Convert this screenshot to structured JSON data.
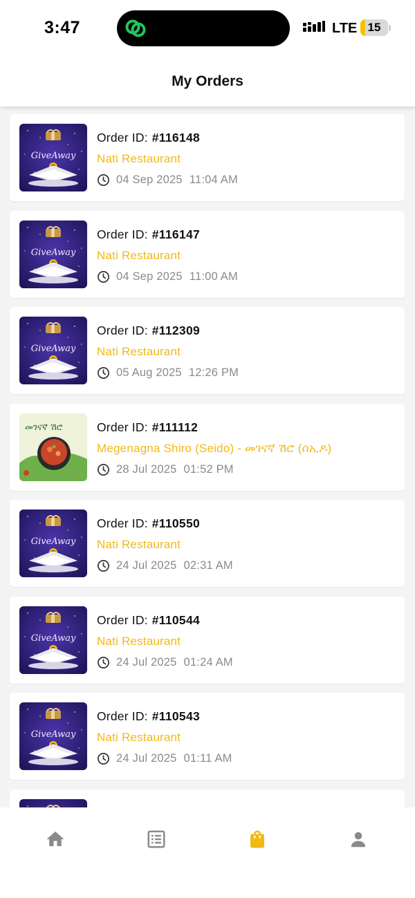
{
  "status_bar": {
    "time": "3:47",
    "network": "LTE",
    "battery": "15",
    "battery_level": 0.15
  },
  "header": {
    "title": "My Orders"
  },
  "order_id_label": "Order ID:",
  "orders": [
    {
      "id": "#116148",
      "restaurant": "Nati Restaurant",
      "date": "04 Sep 2025",
      "time": "11:04 AM",
      "thumb": "giveaway",
      "thumb_text": "GiveAway"
    },
    {
      "id": "#116147",
      "restaurant": "Nati Restaurant",
      "date": "04 Sep 2025",
      "time": "11:00 AM",
      "thumb": "giveaway",
      "thumb_text": "GiveAway"
    },
    {
      "id": "#112309",
      "restaurant": "Nati Restaurant",
      "date": "05 Aug 2025",
      "time": "12:26 PM",
      "thumb": "giveaway",
      "thumb_text": "GiveAway"
    },
    {
      "id": "#111112",
      "restaurant": "Megenagna Shiro (Seido) - መገናኛ ሽሮ (ሰኢዶ)",
      "date": "28 Jul 2025",
      "time": "01:52 PM",
      "thumb": "shiro",
      "thumb_text": "መገናኛ ሽሮ"
    },
    {
      "id": "#110550",
      "restaurant": "Nati Restaurant",
      "date": "24 Jul 2025",
      "time": "02:31 AM",
      "thumb": "giveaway",
      "thumb_text": "GiveAway"
    },
    {
      "id": "#110544",
      "restaurant": "Nati Restaurant",
      "date": "24 Jul 2025",
      "time": "01:24 AM",
      "thumb": "giveaway",
      "thumb_text": "GiveAway"
    },
    {
      "id": "#110543",
      "restaurant": "Nati Restaurant",
      "date": "24 Jul 2025",
      "time": "01:11 AM",
      "thumb": "giveaway",
      "thumb_text": "GiveAway"
    },
    {
      "id": "",
      "restaurant": "",
      "date": "",
      "time": "",
      "thumb": "giveaway",
      "thumb_text": ""
    }
  ],
  "bottom_nav": [
    {
      "name": "home",
      "icon": "home-icon",
      "active": false
    },
    {
      "name": "menu",
      "icon": "list-icon",
      "active": false
    },
    {
      "name": "orders",
      "icon": "shopping-bag-icon",
      "active": true
    },
    {
      "name": "profile",
      "icon": "person-icon",
      "active": false
    }
  ],
  "colors": {
    "accent": "#f2b913",
    "inactive_icon": "#8a8a8a",
    "background": "#f4f4f5",
    "giveaway_bg": "#2a1d6b",
    "shiro_bg": "#eef3da"
  }
}
